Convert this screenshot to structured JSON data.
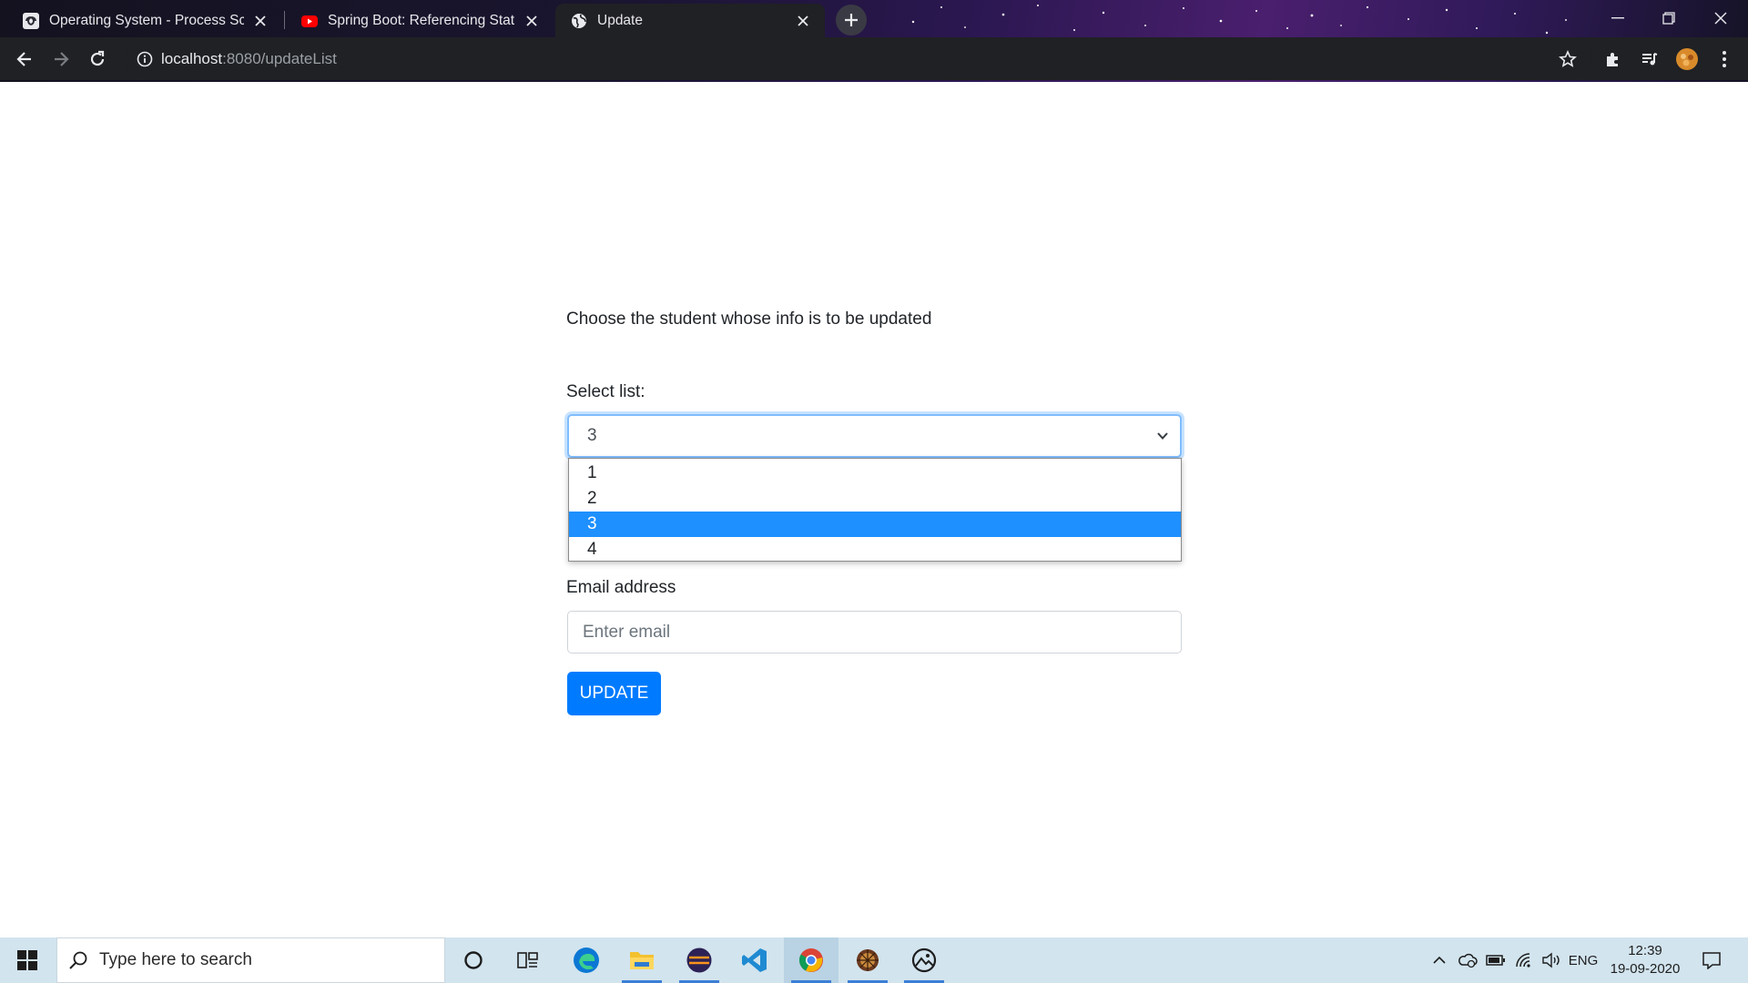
{
  "browser": {
    "tabs": [
      {
        "title": "Operating System - Process Sche",
        "active": false
      },
      {
        "title": "Spring Boot: Referencing Static C",
        "active": false
      },
      {
        "title": "Update",
        "active": true
      }
    ],
    "url_host": "localhost",
    "url_rest": ":8080/updateList"
  },
  "page": {
    "heading": "Choose the student whose info is to be updated",
    "select_label": "Select list:",
    "select_value": "3",
    "options": [
      "1",
      "2",
      "3",
      "4"
    ],
    "selected_index": 2,
    "email_label": "Email address",
    "email_placeholder": "Enter email",
    "update_button": "UPDATE"
  },
  "taskbar": {
    "search_placeholder": "Type here to search",
    "language": "ENG",
    "time": "12:39",
    "date": "19-09-2020"
  },
  "colors": {
    "primary": "#007bff",
    "option_highlight": "#1e90ff",
    "focus_border": "#80bdff"
  }
}
